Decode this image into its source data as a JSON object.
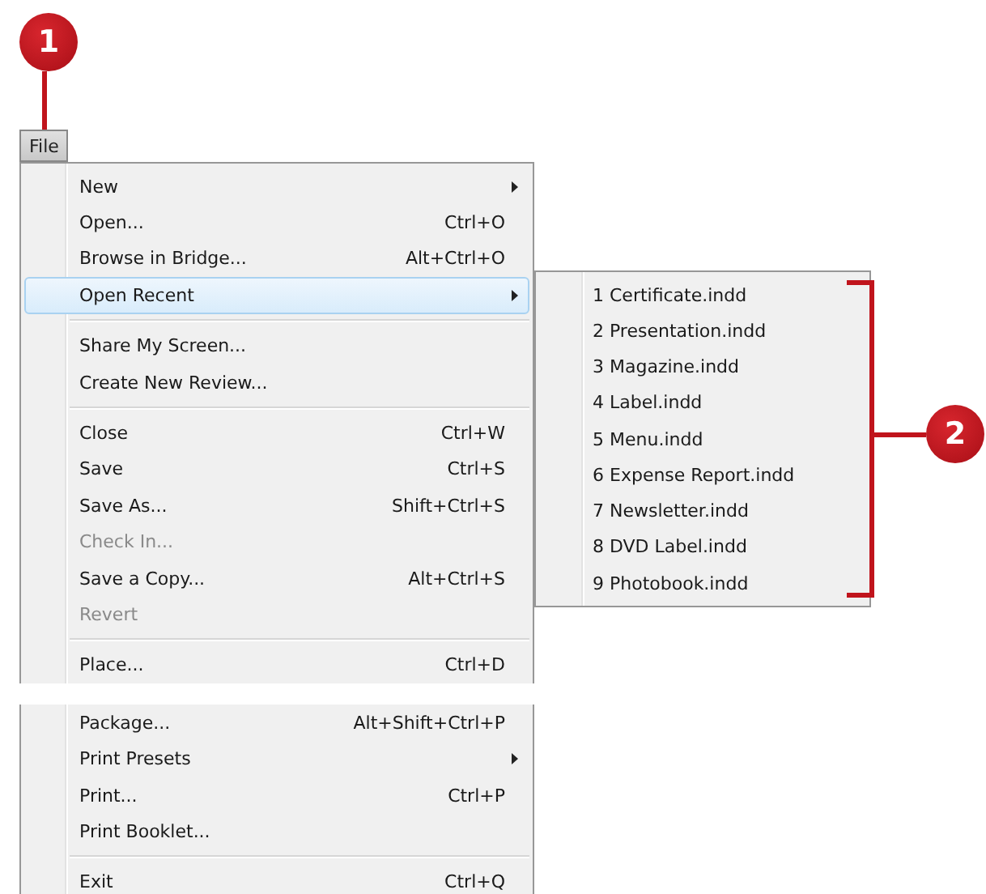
{
  "callouts": [
    {
      "number": "1"
    },
    {
      "number": "2"
    }
  ],
  "menu_bar": {
    "label": "File",
    "selected": true
  },
  "file_menu": [
    {
      "kind": "item",
      "label": "New",
      "has_submenu": true,
      "disabled": false,
      "selected": false
    },
    {
      "kind": "item",
      "label": "Open...",
      "shortcut": "Ctrl+O",
      "has_submenu": false,
      "disabled": false,
      "selected": false
    },
    {
      "kind": "item",
      "label": "Browse in Bridge...",
      "shortcut": "Alt+Ctrl+O",
      "has_submenu": false,
      "disabled": false,
      "selected": false
    },
    {
      "kind": "item",
      "label": "Open Recent",
      "has_submenu": true,
      "disabled": false,
      "selected": true
    },
    {
      "kind": "separator"
    },
    {
      "kind": "item",
      "label": "Share My Screen...",
      "has_submenu": false,
      "disabled": false,
      "selected": false
    },
    {
      "kind": "item",
      "label": "Create New Review...",
      "has_submenu": false,
      "disabled": false,
      "selected": false
    },
    {
      "kind": "separator"
    },
    {
      "kind": "item",
      "label": "Close",
      "shortcut": "Ctrl+W",
      "has_submenu": false,
      "disabled": false,
      "selected": false
    },
    {
      "kind": "item",
      "label": "Save",
      "shortcut": "Ctrl+S",
      "has_submenu": false,
      "disabled": false,
      "selected": false
    },
    {
      "kind": "item",
      "label": "Save As...",
      "shortcut": "Shift+Ctrl+S",
      "has_submenu": false,
      "disabled": false,
      "selected": false
    },
    {
      "kind": "item",
      "label": "Check In...",
      "has_submenu": false,
      "disabled": true,
      "selected": false
    },
    {
      "kind": "item",
      "label": "Save a Copy...",
      "shortcut": "Alt+Ctrl+S",
      "has_submenu": false,
      "disabled": false,
      "selected": false
    },
    {
      "kind": "item",
      "label": "Revert",
      "has_submenu": false,
      "disabled": true,
      "selected": false
    },
    {
      "kind": "separator"
    },
    {
      "kind": "item",
      "label": "Place...",
      "shortcut": "Ctrl+D",
      "has_submenu": false,
      "disabled": false,
      "selected": false
    },
    {
      "kind": "break"
    },
    {
      "kind": "item",
      "label": "Package...",
      "shortcut": "Alt+Shift+Ctrl+P",
      "has_submenu": false,
      "disabled": false,
      "selected": false
    },
    {
      "kind": "item",
      "label": "Print Presets",
      "has_submenu": true,
      "disabled": false,
      "selected": false
    },
    {
      "kind": "item",
      "label": "Print...",
      "shortcut": "Ctrl+P",
      "has_submenu": false,
      "disabled": false,
      "selected": false
    },
    {
      "kind": "item",
      "label": "Print Booklet...",
      "has_submenu": false,
      "disabled": false,
      "selected": false
    },
    {
      "kind": "separator"
    },
    {
      "kind": "item",
      "label": "Exit",
      "shortcut": "Ctrl+Q",
      "has_submenu": false,
      "disabled": false,
      "selected": false
    }
  ],
  "open_recent_submenu": [
    {
      "label": "1 Certificate.indd"
    },
    {
      "label": "2 Presentation.indd"
    },
    {
      "label": "3 Magazine.indd"
    },
    {
      "label": "4 Label.indd"
    },
    {
      "label": "5 Menu.indd"
    },
    {
      "label": "6 Expense Report.indd"
    },
    {
      "label": "7 Newsletter.indd"
    },
    {
      "label": "8 DVD Label.indd"
    },
    {
      "label": "9 Photobook.indd"
    }
  ]
}
